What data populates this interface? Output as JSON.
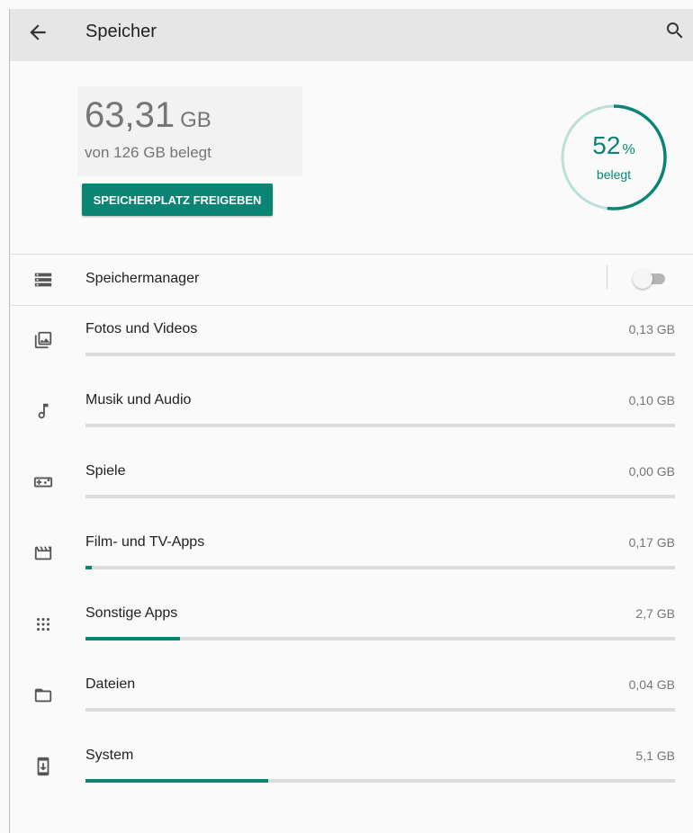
{
  "app_bar": {
    "title": "Speicher",
    "back_icon": "arrow-back-icon",
    "search_icon": "search-icon"
  },
  "summary": {
    "used_value": "63,31",
    "used_unit": "GB",
    "of_total": "von 126 GB belegt",
    "free_button_label": "SPEICHERPLATZ FREIGEBEN",
    "percent_value": "52",
    "percent_sign": "%",
    "percent_label": "belegt",
    "percent_used": 52
  },
  "manager": {
    "label": "Speichermanager",
    "icon": "storage-icon",
    "toggle_on": false
  },
  "categories": [
    {
      "label": "Fotos und Videos",
      "size": "0,13 GB",
      "fill_percent": 0,
      "icon": "photo-icon"
    },
    {
      "label": "Musik und Audio",
      "size": "0,10 GB",
      "fill_percent": 0,
      "icon": "music-note-icon"
    },
    {
      "label": "Spiele",
      "size": "0,00 GB",
      "fill_percent": 0,
      "icon": "gamepad-icon"
    },
    {
      "label": "Film- und TV-Apps",
      "size": "0,17 GB",
      "fill_percent": 1,
      "icon": "movie-icon"
    },
    {
      "label": "Sonstige Apps",
      "size": "2,7 GB",
      "fill_percent": 16,
      "icon": "apps-icon"
    },
    {
      "label": "Dateien",
      "size": "0,04 GB",
      "fill_percent": 0,
      "icon": "folder-icon"
    },
    {
      "label": "System",
      "size": "5,1 GB",
      "fill_percent": 31,
      "icon": "system-update-icon"
    }
  ],
  "colors": {
    "accent": "#0a8573",
    "ring_track": "#b9e0d9",
    "app_bar": "#e6e6e6",
    "bar_track": "#dcdcdc"
  }
}
